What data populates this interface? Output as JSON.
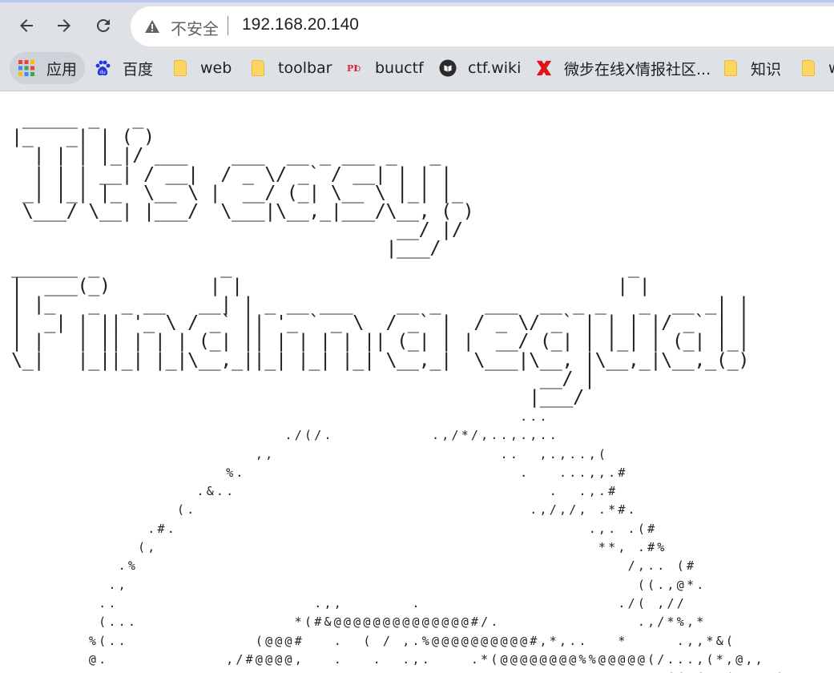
{
  "browser": {
    "security_label": "不安全",
    "url": "192.168.20.140",
    "bookmarks": [
      {
        "label": "应用",
        "icon": "apps-grid-icon"
      },
      {
        "label": "百度",
        "icon": "baidu-paw-icon"
      },
      {
        "label": "web",
        "icon": "folder-icon"
      },
      {
        "label": "toolbar",
        "icon": "folder-icon"
      },
      {
        "label": "buuctf",
        "icon": "buuctf-icon"
      },
      {
        "label": "ctf.wiki",
        "icon": "ctf-wiki-icon"
      },
      {
        "label": "微步在线X情报社区...",
        "icon": "threatbook-x-icon"
      },
      {
        "label": "知识",
        "icon": "folder-icon"
      },
      {
        "label": "w",
        "icon": "folder-icon"
      }
    ]
  },
  "page": {
    "title_art": " _____ _   _\n|_   _| | ( )\n  | | | |_|/ ___    ___  __ _ ___ _   _\n  | | | __| / __|  / _ \\/ _` / __| | | |\n _| |_| |_  \\__ \\ |  __/ (_| \\__ \\ |_| |_\n \\___/ \\__| |___/  \\___|\\__,_|___/\\__, ( )\n                                   __/ |/\n                                  |___/\n______ _           _                                    _\n|  ___(_)         | |                                  | |\n| |_   _  _ __   __| | _ __ ___    __ _    ___  __ _ _   _  __ _| |\n|  _| | || '_ \\ / _` || '_ ` _ \\  / _` |  / _ \\/ _` | | | |/ _` | |\n| |   | || | | | (_| || | | | | || (_| | |  __/ (_| | |_| | (_| |_|\n\\_|   |_||_| |_|\\__,_||_| |_| |_| \\__,_|  \\___|\\__, |\\__,_|\\__,_(_)\n                                                __/ |\n                                               |___/",
    "logo_art": "                                                ...\n                        ./(/.          .,/*/,..,.,..\n                     ,,                       ..  ,.,..,(\n                  %.                            .   ...,,.#\n               .&..                                .  .,.#\n             (.                                  .,/,/, .*#.\n          .#.                                          .,. .(#\n         (,                                             **, .#%\n       .%                                                  /,.. (#\n      .,                                                    ((.,@*.\n     ..                    .,,       .                    ./( ,//\n     (...                *(#&@@@@@@@@@@@@@@#/.              .,/*%,*\n    %(..             (@@@#   .  ( / ,.%@@@@@@@@@@#,*,..   *     .,,*&(\n    @.            ,/#@@@@,   .   .  .,.    .*(@@@@@@@@%%@@@@@(/...,(*,@,,\n   *@          /#@@@@@@@@    /*/.                 &@@@@@@@@@@@&((%( /(/#&&("
  }
}
